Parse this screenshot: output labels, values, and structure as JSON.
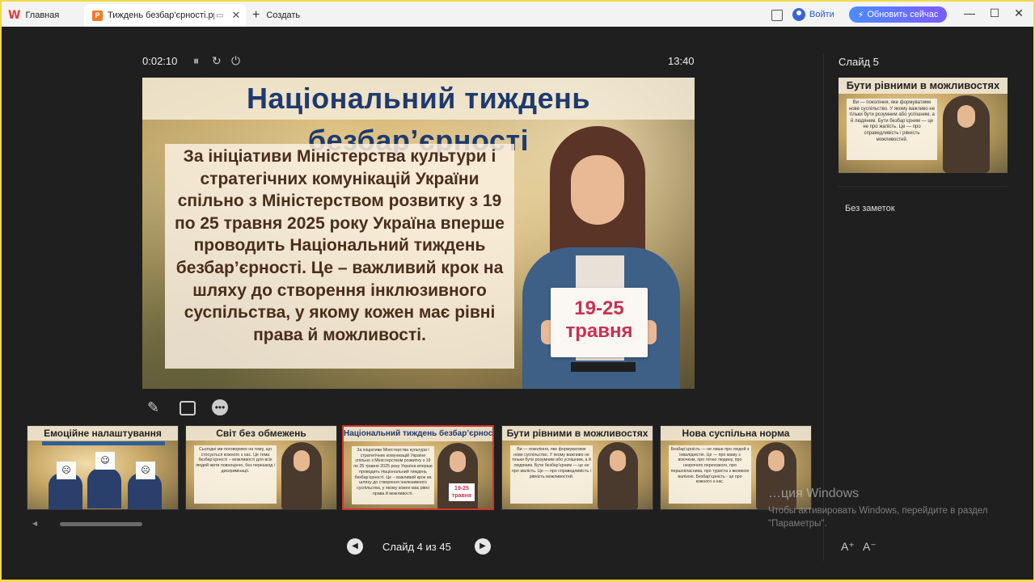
{
  "tabs": {
    "home_label": "Главная",
    "doc_title": "Тиждень безбар'єрності.ppt",
    "new_label": "Создать"
  },
  "topbar": {
    "login_label": "Войти",
    "update_label": "Обновить сейчас",
    "minimize": "—",
    "maximize": "☐",
    "close": "✕"
  },
  "presenter": {
    "elapsed": "0:02:10",
    "clock": "13:40",
    "pause_icon": "⏸",
    "restart_icon": "↻",
    "power_icon": "⏻"
  },
  "slide": {
    "title": "Національний тиждень безбар’єрності",
    "body": "За ініціативи Міністерства культури і стратегічних комунікацій України спільно з Міністерством розвитку з 19 по 25 травня 2025 року Україна вперше проводить Національний тиждень безбар’єрності. Це – важливий крок на шляху до створення інклюзивного суспільства, у якому кожен має рівні права й можливості.",
    "sign_line1": "19-25",
    "sign_line2": "травня"
  },
  "filmstrip": [
    {
      "title": "Емоційне налаштування",
      "text": ""
    },
    {
      "title": "Світ без обмежень",
      "text": "Сьогодні ми поговоримо на тему, що стосується кожного з нас. Це тема безбар’єрності – можливості для всіх людей жити повноцінно, без перешкод і дискримінації."
    },
    {
      "title": "Національний тиждень безбар’єрності",
      "text": "За ініціативи Міністерства культури і стратегічних комунікацій України спільно з Міністерством розвитку з 19 по 25 травня 2025 року Україна вперше проводить Національний тиждень безбар’єрності. Це – важливий крок на шляху до створення інклюзивного суспільства, у якому кожен має рівні права й можливості.",
      "sign": "19-25 травня"
    },
    {
      "title": "Бути рівними в можливостях",
      "text": "Ви — покоління, яке формуватиме нове суспільство. У якому важливо не тільки бути розумним або успішним, а й людяним. Бути безбар’єрним — це не про жалість. Це — про справедливість і рівність можливостей."
    },
    {
      "title": "Нова суспільна норма",
      "text": "Безбар’єрність — не лише про людей з інвалідністю. Це — про маму з візочком, про літню людину, про незрячого перехожого, про першокласника, про туриста з великою валізою. Безбар’єрність - це про кожного з нас."
    }
  ],
  "navigation": {
    "prev_icon": "◀",
    "next_icon": "▶",
    "counter": "Слайд 4 из 45"
  },
  "right_pane": {
    "next_label": "Слайд 5",
    "next_title": "Бути рівними в можливостях",
    "next_text": "Ви — покоління, яке формуватиме нове суспільство. У якому важливо не тільки бути розумним або успішним, а й людяним. Бути безбар’єрним — це не про жалість. Це — про справедливість і рівність можливостей.",
    "notes": "Без заметок",
    "font_increase": "A⁺",
    "font_decrease": "A⁻"
  },
  "watermark": {
    "title": "…ция Windows",
    "subtitle": "Чтобы активировать Windows, перейдите в раздел \"Параметры\"."
  },
  "colors": {
    "accent_update": "#4b8bff",
    "active_thumb_border": "#d2342c",
    "title_blue": "#1e3a6e",
    "sign_red": "#c83252"
  }
}
